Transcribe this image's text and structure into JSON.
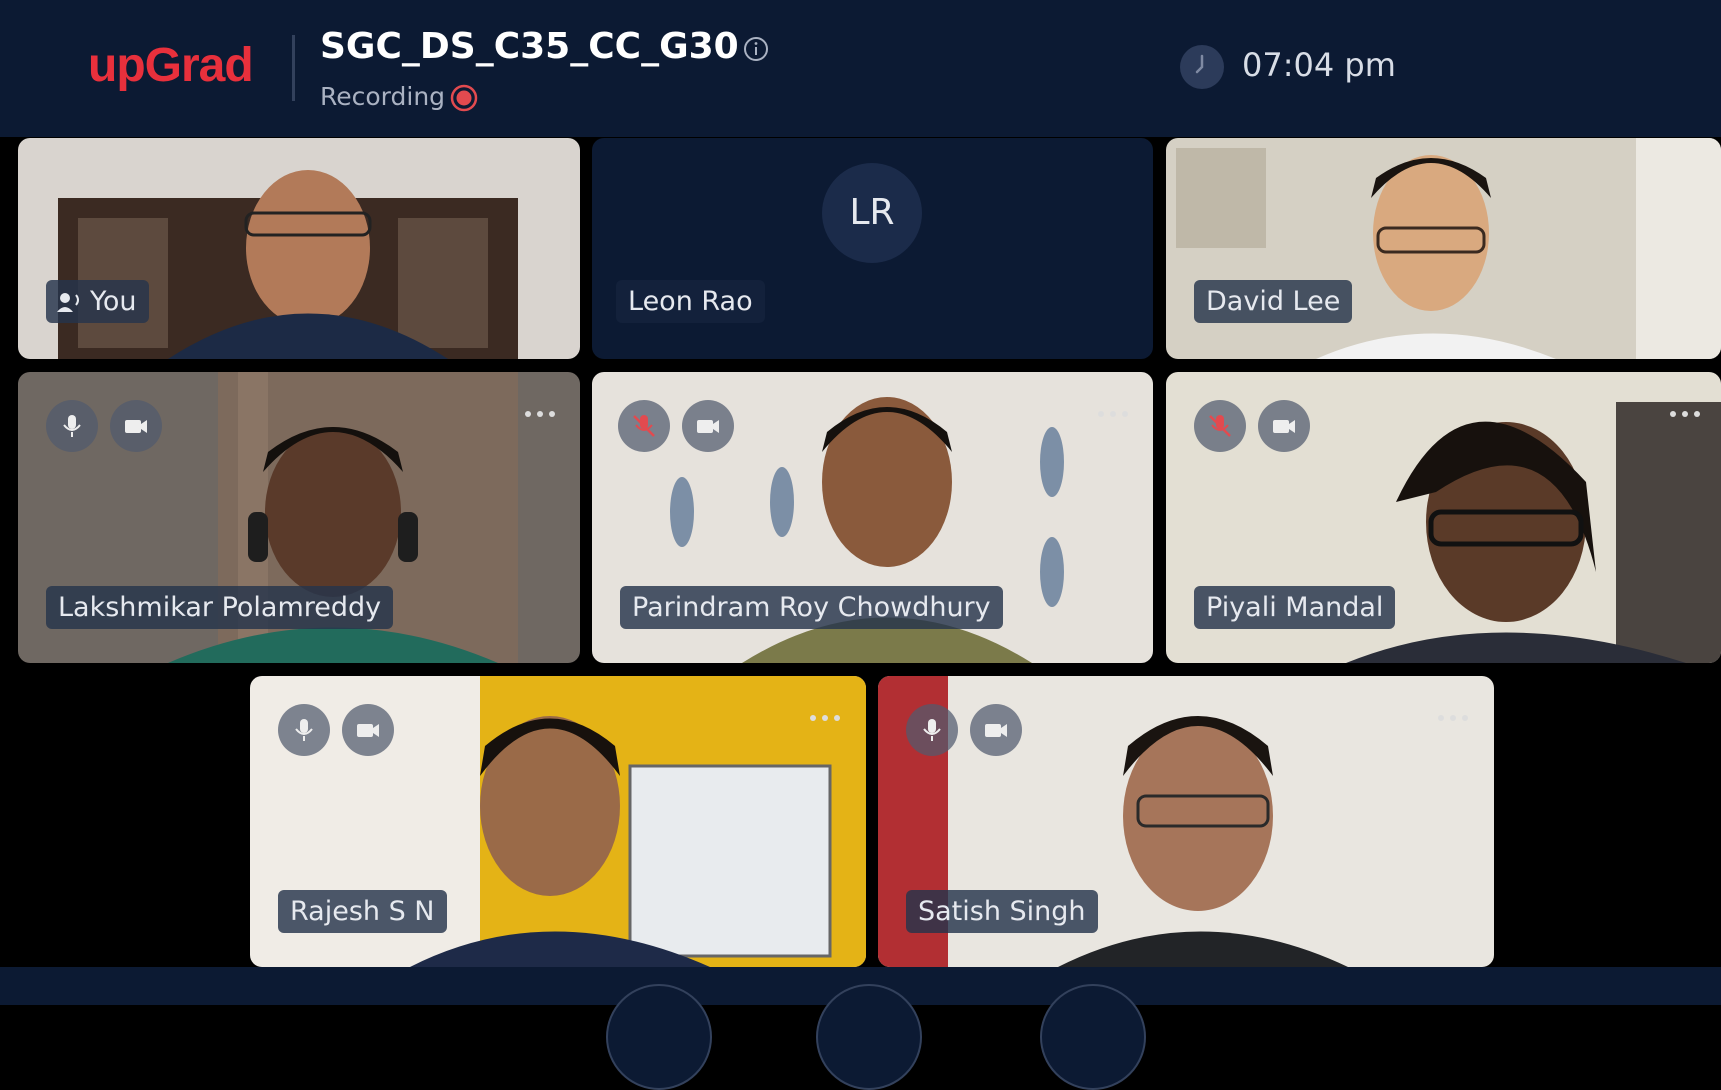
{
  "header": {
    "logo_text": "upGrad",
    "meeting_title": "SGC_DS_C35_CC_G30",
    "recording_label": "Recording",
    "time": "07:04 pm"
  },
  "colors": {
    "topbar_bg": "#0c1a33",
    "brand_red": "#e8303c",
    "recording_red": "#e24a4f",
    "name_label_bg": "#26344c"
  },
  "participants": [
    {
      "name": "You",
      "mic": "speaking",
      "video": "on"
    },
    {
      "name": "Leon Rao",
      "initials": "LR",
      "video": "off"
    },
    {
      "name": "David Lee",
      "video": "on"
    },
    {
      "name": "Lakshmikar Polamreddy",
      "mic": "on",
      "video": "on"
    },
    {
      "name": "Parindram Roy Chowdhury",
      "mic": "muted",
      "video": "on"
    },
    {
      "name": "Piyali Mandal",
      "mic": "muted",
      "video": "on"
    },
    {
      "name": "Rajesh S N",
      "mic": "on",
      "video": "on"
    },
    {
      "name": "Satish Singh",
      "mic": "on",
      "video": "on"
    }
  ],
  "icons": {
    "info": "info-icon",
    "recording": "record-icon",
    "clock": "clock-icon",
    "mic": "mic-icon",
    "mic_muted": "mic-muted-icon",
    "camera": "camera-icon",
    "more": "more-options-icon",
    "speaker": "speaker-icon"
  }
}
